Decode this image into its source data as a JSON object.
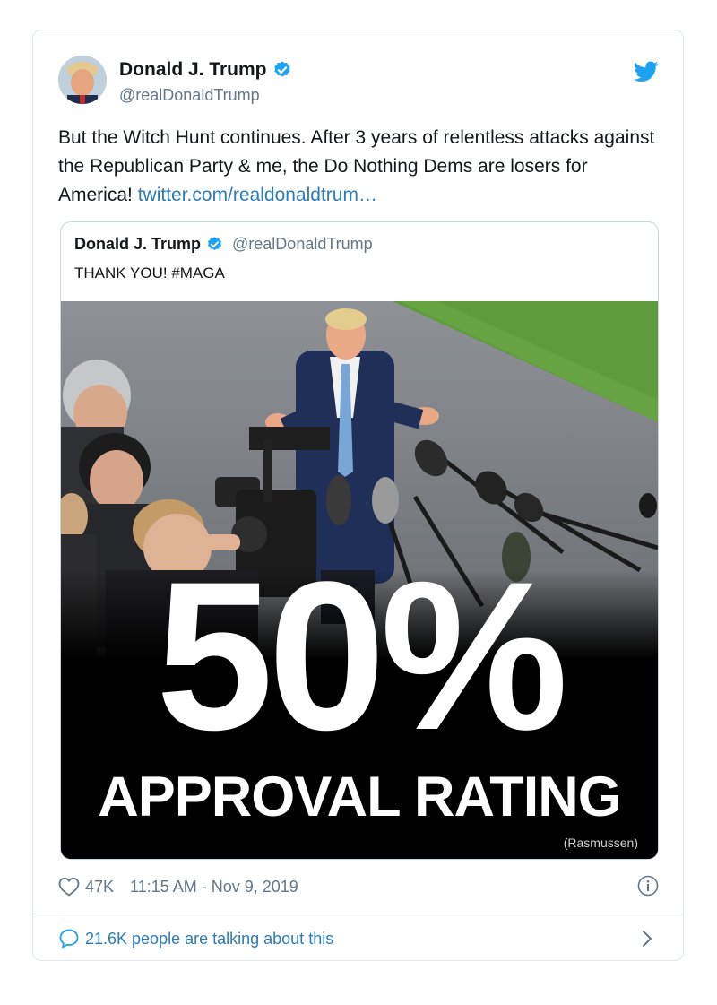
{
  "author": {
    "name": "Donald J. Trump",
    "handle": "@realDonaldTrump"
  },
  "tweet": {
    "text": "But the Witch Hunt continues. After 3 years of relentless attacks against the Republican Party & me, the Do Nothing Dems are losers for America!",
    "link": "twitter.com/realdonaldtrum…"
  },
  "quoted": {
    "name": "Donald J. Trump",
    "handle": "@realDonaldTrump",
    "text": "THANK YOU! #MAGA",
    "image_headline": "50%",
    "image_subheadline": "APPROVAL RATING",
    "image_source": "(Rasmussen)"
  },
  "footer": {
    "likes": "47K",
    "timestamp": "11:15 AM - Nov 9, 2019",
    "talking": "21.6K people are talking about this"
  },
  "colors": {
    "accent": "#1da1f2",
    "link": "#2b7bb9",
    "muted": "#657786",
    "border": "#e1e8ed"
  },
  "icons": [
    "verified-badge-icon",
    "twitter-bird-icon",
    "heart-icon",
    "info-icon",
    "speech-bubble-icon",
    "chevron-right-icon"
  ]
}
